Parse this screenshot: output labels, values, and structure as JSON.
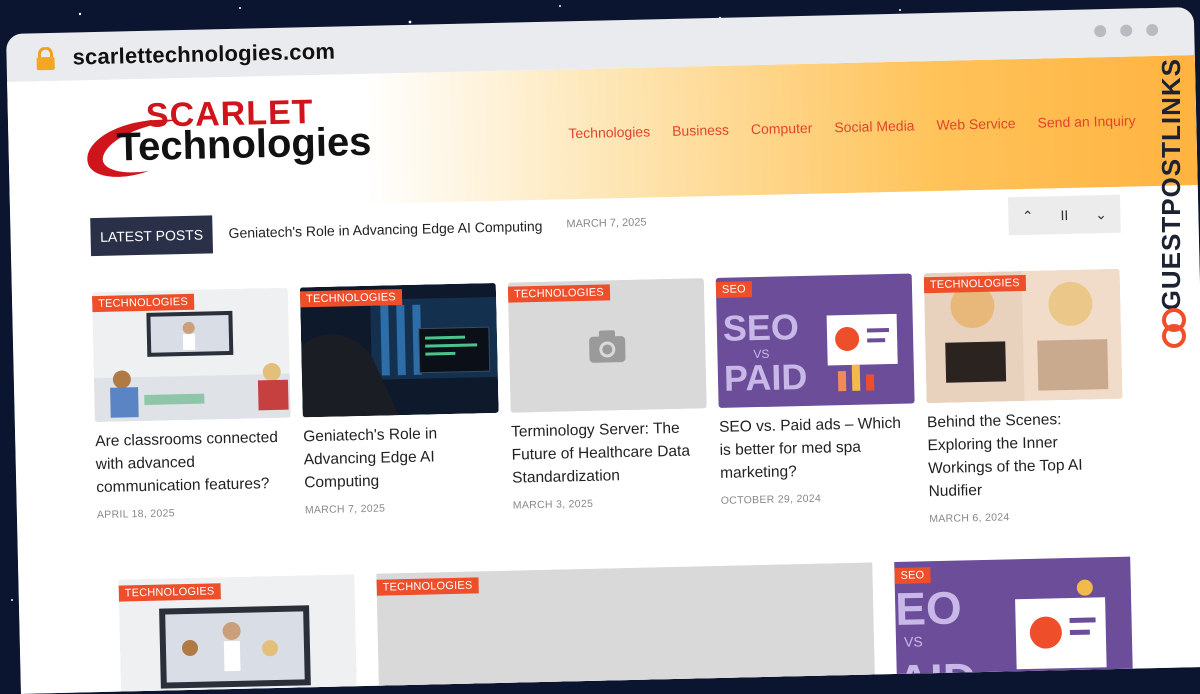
{
  "browser": {
    "url": "scarlettechnologies.com"
  },
  "logo": {
    "line1": "SCARLET",
    "line2": "Technologies"
  },
  "nav": {
    "items": [
      "Technologies",
      "Business",
      "Computer",
      "Social Media",
      "Web Service",
      "Send an Inquiry"
    ]
  },
  "ticker": {
    "label": "LATEST POSTS",
    "title": "Geniatech's Role in Advancing Edge AI Computing",
    "date": "MARCH 7, 2025",
    "up": "⌃",
    "pause": "II",
    "down": "⌄"
  },
  "posts": [
    {
      "category": "TECHNOLOGIES",
      "title": "Are classrooms connected with advanced communication features?",
      "date": "APRIL 18, 2025"
    },
    {
      "category": "TECHNOLOGIES",
      "title": "Geniatech's Role in Advancing Edge AI Computing",
      "date": "MARCH 7, 2025"
    },
    {
      "category": "TECHNOLOGIES",
      "title": "Terminology Server: The Future of Healthcare Data Standardization",
      "date": "MARCH 3, 2025"
    },
    {
      "category": "SEO",
      "title": "SEO vs. Paid ads – Which is better for med spa marketing?",
      "date": "OCTOBER 29, 2024",
      "thumb_text1": "SEO",
      "thumb_text2": "VS",
      "thumb_text3": "PAID"
    },
    {
      "category": "TECHNOLOGIES",
      "title": "Behind the Scenes: Exploring the Inner Workings of the Top AI Nudifier",
      "date": "MARCH 6, 2024"
    }
  ],
  "featured": [
    {
      "category": "TECHNOLOGIES"
    },
    {
      "category": "TECHNOLOGIES"
    },
    {
      "category": "SEO",
      "thumb_text1": "EO",
      "thumb_text2": "VS",
      "thumb_text3": "AID"
    }
  ],
  "watermark": {
    "text": "GUESTPOSTLINKS"
  },
  "colors": {
    "accent": "#ef4e2b",
    "nav": "#e0452a",
    "ticker_label_bg": "#2b3049",
    "seo_purple": "#6b4d99"
  }
}
